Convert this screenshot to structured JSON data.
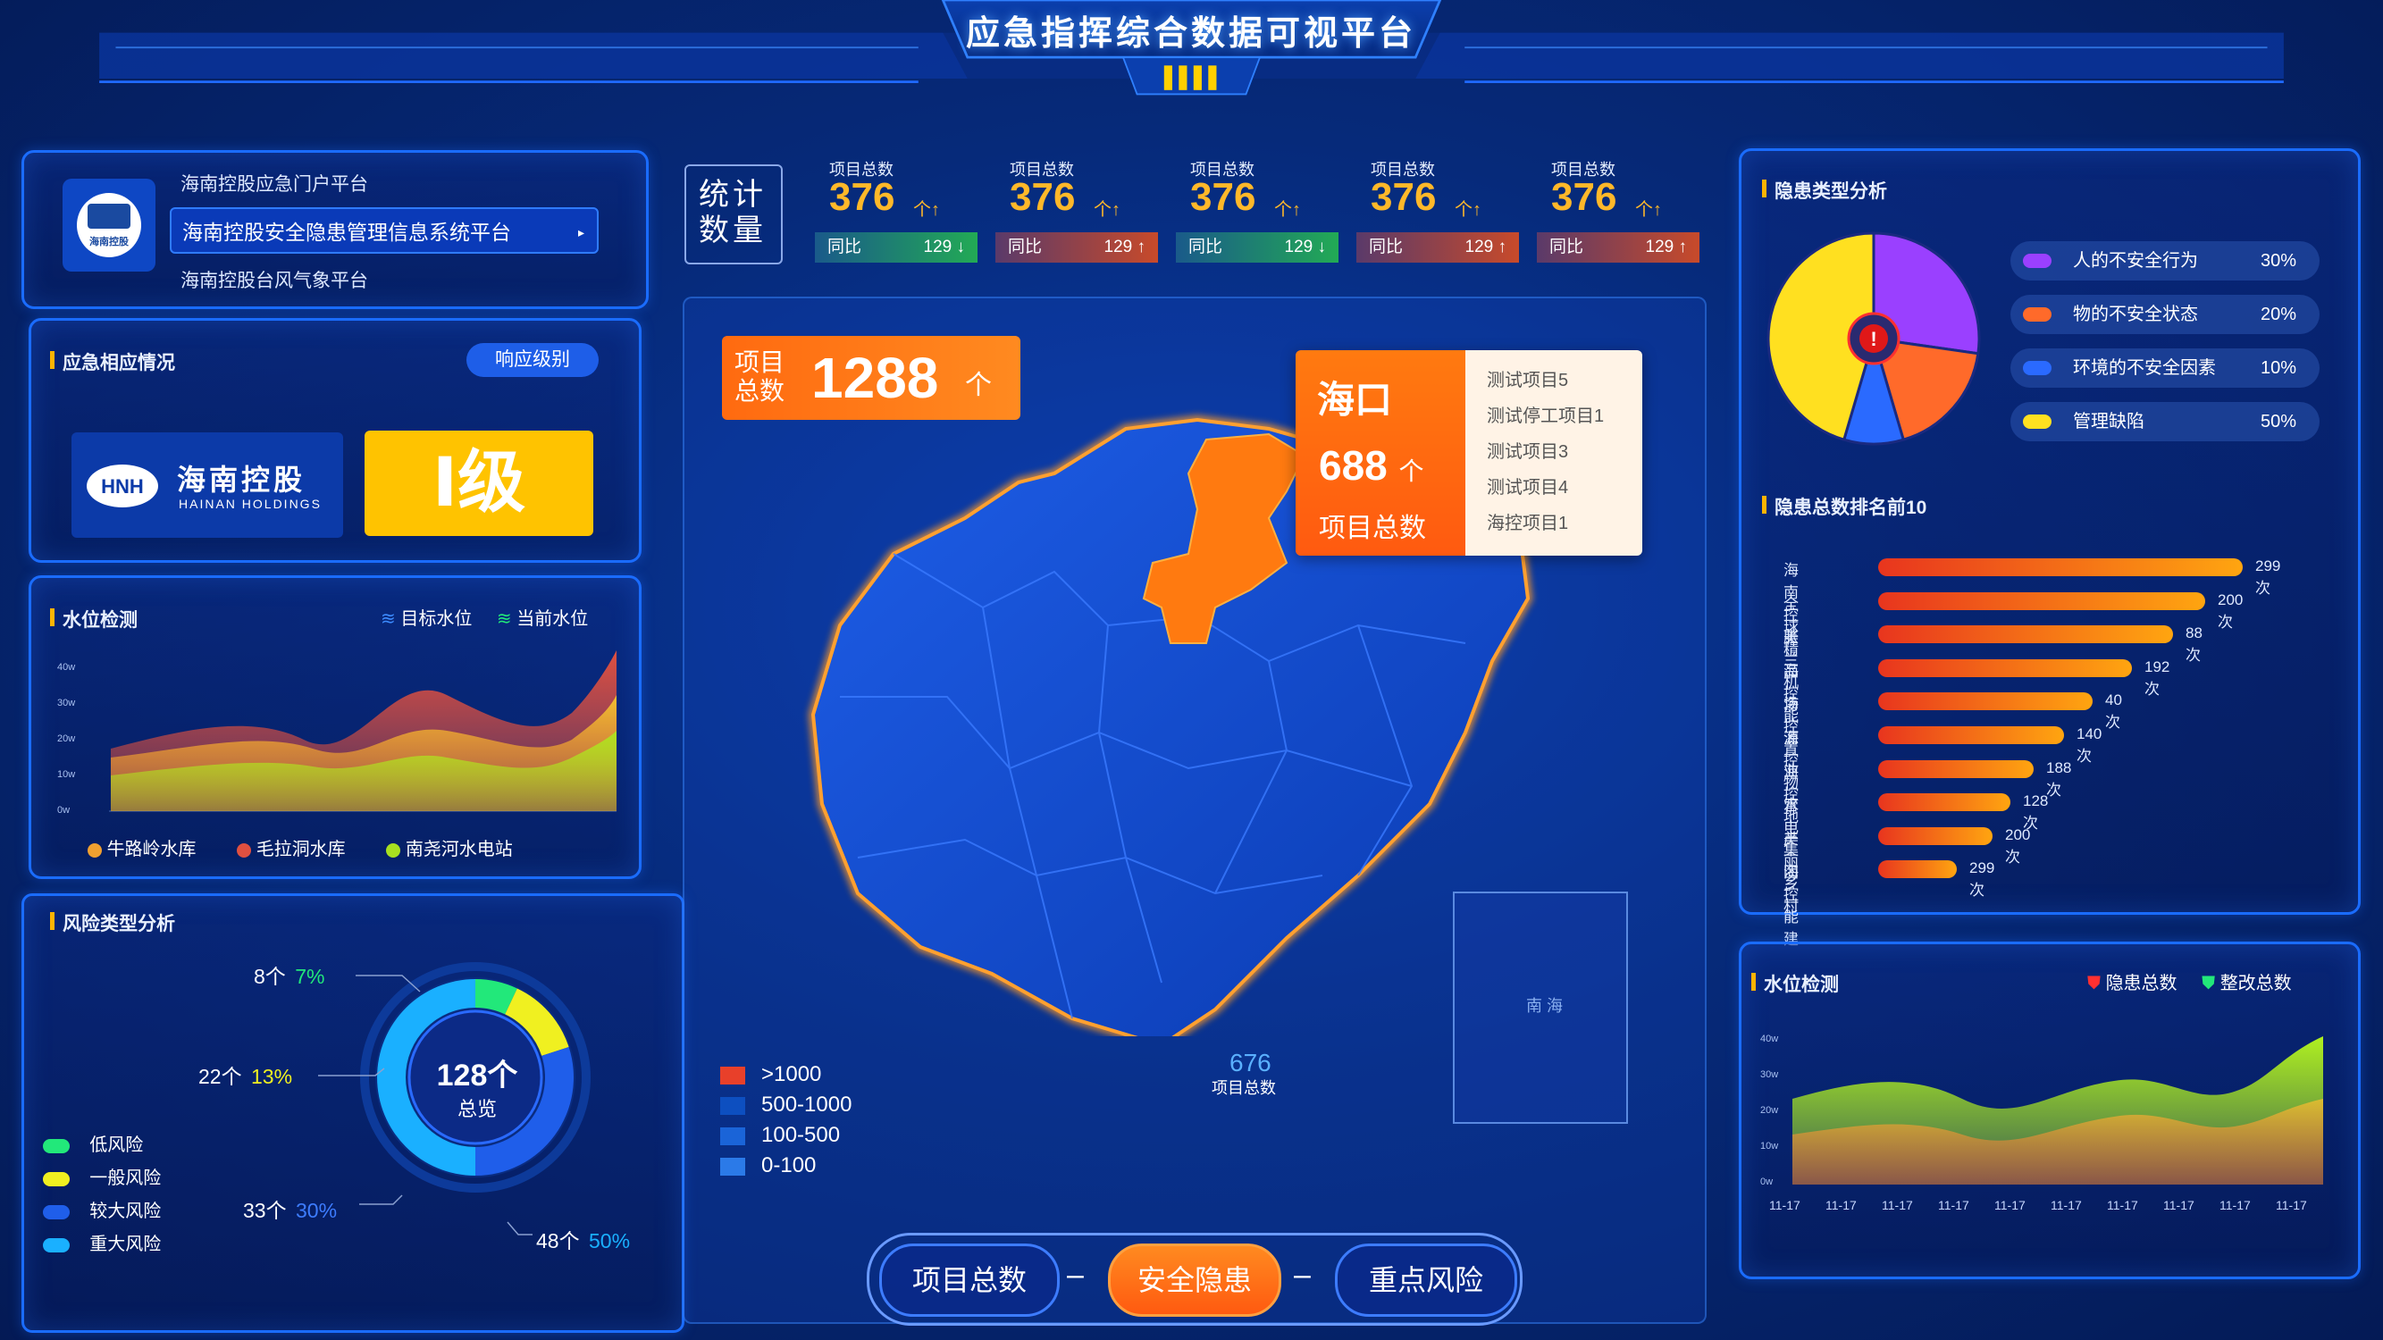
{
  "header": {
    "title": "应急指挥综合数据可视平台"
  },
  "portal": {
    "items": [
      "海南控股应急门户平台",
      "海南控股安全隐患管理信息系统平台",
      "海南控股台风气象平台"
    ],
    "active_index": 1,
    "logo_text": "海南控股"
  },
  "emergency": {
    "title": "应急相应情况",
    "response_btn": "响应级别",
    "company_cn": "海南控股",
    "company_en": "HAINAN HOLDINGS",
    "level": "Ⅰ级"
  },
  "water_left": {
    "title": "水位检测",
    "legend": [
      "目标水位",
      "当前水位"
    ],
    "y_ticks": [
      "40w",
      "30w",
      "20w",
      "10w",
      "0w"
    ],
    "stations": [
      "牛路岭水库",
      "毛拉洞水库",
      "南尧河水电站"
    ],
    "station_colors": [
      "#f0a030",
      "#e05040",
      "#a8e020"
    ]
  },
  "risk": {
    "title": "风险类型分析",
    "total": "128个",
    "total_label": "总览",
    "segments": [
      {
        "name": "低风险",
        "count": "8个",
        "pct": "7%",
        "value": 7,
        "color": "#22e87a"
      },
      {
        "name": "一般风险",
        "count": "22个",
        "pct": "13%",
        "value": 13,
        "color": "#f0f020"
      },
      {
        "name": "较大风险",
        "count": "33个",
        "pct": "30%",
        "value": 30,
        "color": "#1f5eea"
      },
      {
        "name": "重大风险",
        "count": "48个",
        "pct": "50%",
        "value": 50,
        "color": "#1ab0ff"
      }
    ],
    "pct_colors": [
      "#22e87a",
      "#f0f020",
      "#3d7cff",
      "#1ab0ff"
    ]
  },
  "stats": {
    "label": "统计数量",
    "cards": [
      {
        "title": "项目总数",
        "value": "376",
        "unit": "个",
        "yoy_label": "同比",
        "yoy_value": "129",
        "trend": "down"
      },
      {
        "title": "项目总数",
        "value": "376",
        "unit": "个",
        "yoy_label": "同比",
        "yoy_value": "129",
        "trend": "up"
      },
      {
        "title": "项目总数",
        "value": "376",
        "unit": "个",
        "yoy_label": "同比",
        "yoy_value": "129",
        "trend": "down"
      },
      {
        "title": "项目总数",
        "value": "376",
        "unit": "个",
        "yoy_label": "同比",
        "yoy_value": "129",
        "trend": "up"
      },
      {
        "title": "项目总数",
        "value": "376",
        "unit": "个",
        "yoy_label": "同比",
        "yoy_value": "129",
        "trend": "up"
      }
    ]
  },
  "map": {
    "total_label_1": "项目",
    "total_label_2": "总数",
    "total_value": "1288",
    "total_unit": "个",
    "popup": {
      "city": "海口",
      "value": "688",
      "unit": "个",
      "sub": "项目总数",
      "projects": [
        "测试项目5",
        "测试停工项目1",
        "测试项目3",
        "测试项目4",
        "海控项目1"
      ]
    },
    "sub_value": "676",
    "sub_label": "项目总数",
    "legend": [
      {
        "label": ">1000",
        "color": "#e8402a"
      },
      {
        "label": "500-1000",
        "color": "#0d4fc0"
      },
      {
        "label": "100-500",
        "color": "#1a64d8"
      },
      {
        "label": "0-100",
        "color": "#2b7ae8"
      }
    ],
    "inset_label": "南 海"
  },
  "nav": {
    "buttons": [
      "项目总数",
      "安全隐患",
      "重点风险"
    ],
    "active_index": 1
  },
  "hazard": {
    "title": "隐患类型分析",
    "items": [
      {
        "name": "人的不安全行为",
        "pct": "30%",
        "value": 30,
        "color": "#9a40ff"
      },
      {
        "name": "物的不安全状态",
        "pct": "20%",
        "value": 20,
        "color": "#ff6a2a"
      },
      {
        "name": "环境的不安全因素",
        "pct": "10%",
        "value": 10,
        "color": "#2a6aff"
      },
      {
        "name": "管理缺陷",
        "pct": "50%",
        "value": 50,
        "color": "#ffe020"
      }
    ]
  },
  "ranking": {
    "title": "隐患总数排名前10",
    "rows": [
      {
        "name": "海南控胀",
        "value": 299,
        "label": "299次"
      },
      {
        "name": "全球精品",
        "value": 200,
        "label": "200次"
      },
      {
        "name": "美兰机场",
        "value": 88,
        "label": "88次"
      },
      {
        "name": "海控能源",
        "value": 192,
        "label": "192次"
      },
      {
        "name": "海控置业",
        "value": 40,
        "label": "40次"
      },
      {
        "name": "海控物管",
        "value": 140,
        "label": "140次"
      },
      {
        "name": "海控地产",
        "value": 188,
        "label": "188次"
      },
      {
        "name": "水电集团",
        "value": 128,
        "label": "128次"
      },
      {
        "name": "美丽乡村",
        "value": 200,
        "label": "200次"
      },
      {
        "name": "海控能建",
        "value": 299,
        "label": "299次"
      }
    ]
  },
  "water_right": {
    "title": "水位检测",
    "legend": [
      "隐患总数",
      "整改总数"
    ],
    "y_ticks": [
      "40w",
      "30w",
      "20w",
      "10w",
      "0w"
    ],
    "x_ticks": [
      "11-17",
      "11-17",
      "11-17",
      "11-17",
      "11-17",
      "11-17",
      "11-17",
      "11-17",
      "11-17",
      "11-17"
    ]
  }
}
